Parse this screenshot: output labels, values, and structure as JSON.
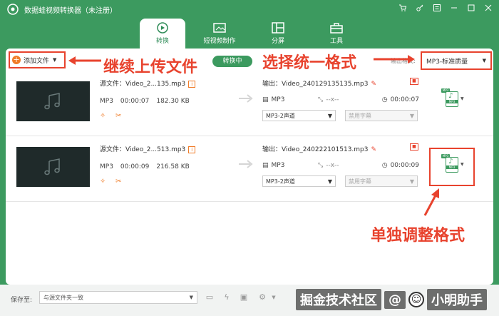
{
  "app": {
    "title": "数据蛙视频转换器（未注册）",
    "accent": "#3c9a5f",
    "annotation_color": "#e8432e"
  },
  "tabs": [
    {
      "label": "转换",
      "icon": "convert-icon",
      "active": true
    },
    {
      "label": "短视频制作",
      "icon": "video-maker-icon",
      "active": false
    },
    {
      "label": "分屏",
      "icon": "split-screen-icon",
      "active": false
    },
    {
      "label": "工具",
      "icon": "toolbox-icon",
      "active": false
    }
  ],
  "toolbar": {
    "add_label": "添加文件",
    "converting_label": "转换中",
    "format_label": "输出格式:",
    "format_value": "MP3-标准质量"
  },
  "files": [
    {
      "src_name": "源文件：Video_2...135.mp3",
      "format": "MP3",
      "duration": "00:00:07",
      "size": "182.30 KB",
      "out_name": "输出：Video_240129135135.mp3",
      "out_format": "MP3",
      "out_res": "--x--",
      "out_duration": "00:00:07",
      "channel": "MP3-2声道",
      "subtitle": "禁用字幕"
    },
    {
      "src_name": "源文件：Video_2...513.mp3",
      "format": "MP3",
      "duration": "00:00:09",
      "size": "216.58 KB",
      "out_name": "输出：Video_240222101513.mp3",
      "out_format": "MP3",
      "out_res": "--x--",
      "out_duration": "00:00:09",
      "channel": "MP3-2声道",
      "subtitle": "禁用字幕"
    }
  ],
  "annotations": {
    "add_more": "继续上传文件",
    "unify_format": "选择统一格式",
    "single_format": "单独调整格式"
  },
  "footer": {
    "save_label": "保存至:",
    "save_value": "与源文件夹一致"
  },
  "watermark": {
    "text": "掘金技术社区",
    "at": "@",
    "user": "小明助手"
  }
}
